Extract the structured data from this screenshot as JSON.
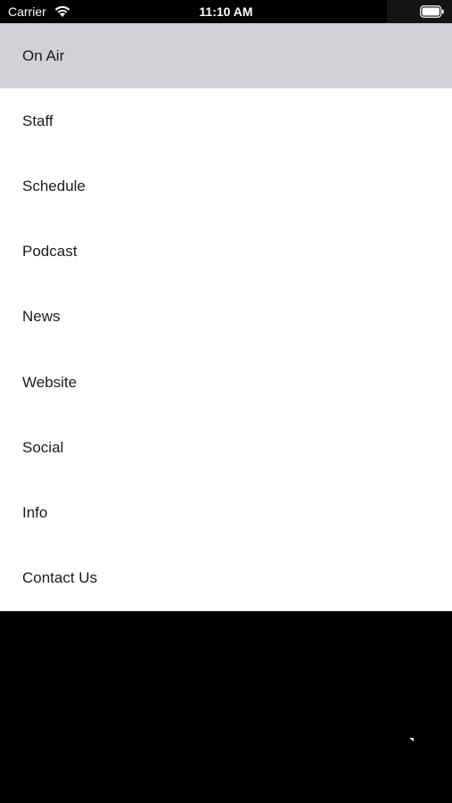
{
  "status_bar": {
    "carrier": "Carrier",
    "time": "11:10 AM",
    "icons": [
      "wifi-icon",
      "battery-icon"
    ]
  },
  "menu": {
    "selected_index": 0,
    "selected_color": "#d1d1d6",
    "items": [
      {
        "label": "On Air"
      },
      {
        "label": "Staff"
      },
      {
        "label": "Schedule"
      },
      {
        "label": "Podcast"
      },
      {
        "label": "News"
      },
      {
        "label": "Website"
      },
      {
        "label": "Social"
      },
      {
        "label": "Info"
      },
      {
        "label": "Contact Us"
      }
    ]
  }
}
